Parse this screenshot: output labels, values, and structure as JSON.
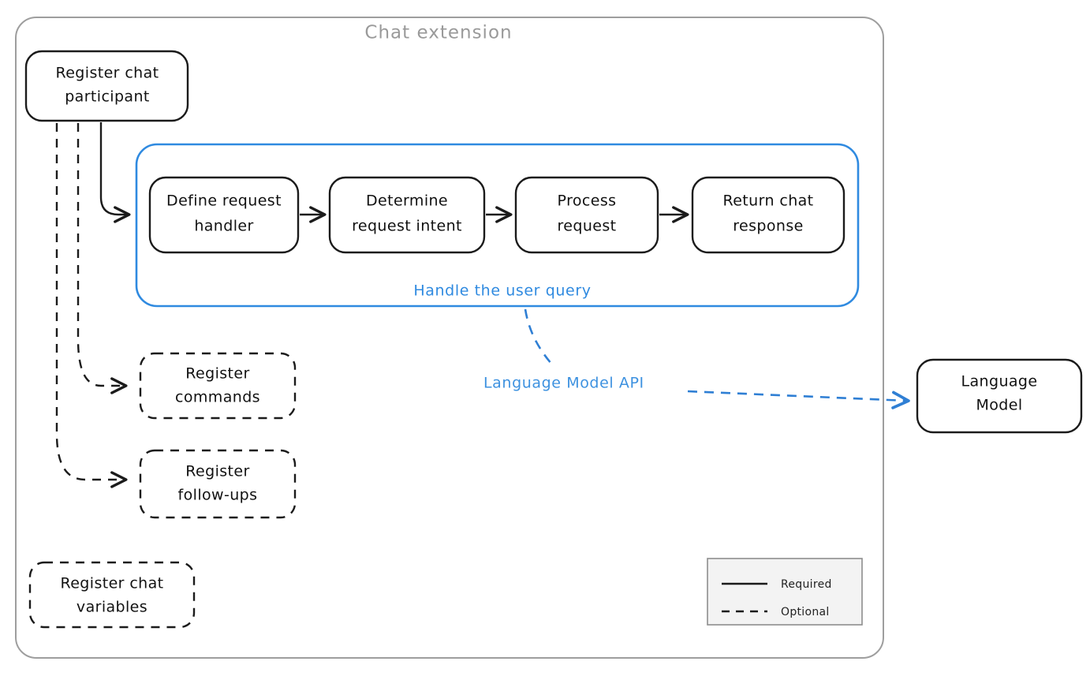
{
  "diagram": {
    "title": "Chat extension",
    "container_label": "Chat extension"
  },
  "group": {
    "caption": "Handle the user query",
    "accent_color": "#2f8ae0"
  },
  "flow_steps": [
    {
      "label_line1": "Define request",
      "label_line2": "handler"
    },
    {
      "label_line1": "Determine",
      "label_line2": "request intent"
    },
    {
      "label_line1": "Process",
      "label_line2": "request"
    },
    {
      "label_line1": "Return chat",
      "label_line2": "response"
    }
  ],
  "nodes": {
    "register_participant": {
      "line1": "Register chat",
      "line2": "participant",
      "style": "solid"
    },
    "register_commands": {
      "line1": "Register",
      "line2": "commands",
      "style": "dashed"
    },
    "register_followups": {
      "line1": "Register",
      "line2": "follow-ups",
      "style": "dashed"
    },
    "register_variables": {
      "line1": "Register chat",
      "line2": "variables",
      "style": "dashed"
    },
    "language_model": {
      "line1": "Language",
      "line2": "Model",
      "style": "solid"
    }
  },
  "edges": {
    "language_model_api_label": "Language Model API"
  },
  "legend": {
    "items": [
      {
        "label": "Required",
        "style": "solid"
      },
      {
        "label": "Optional",
        "style": "dashed"
      }
    ]
  },
  "colors": {
    "accent_blue": "#2f8ae0",
    "edge_blue": "#2f7fd4",
    "stroke_black": "#1b1b1b",
    "container_gray": "#9e9e9e",
    "title_gray": "#9a9a9a",
    "legend_fill": "#f3f3f3"
  }
}
